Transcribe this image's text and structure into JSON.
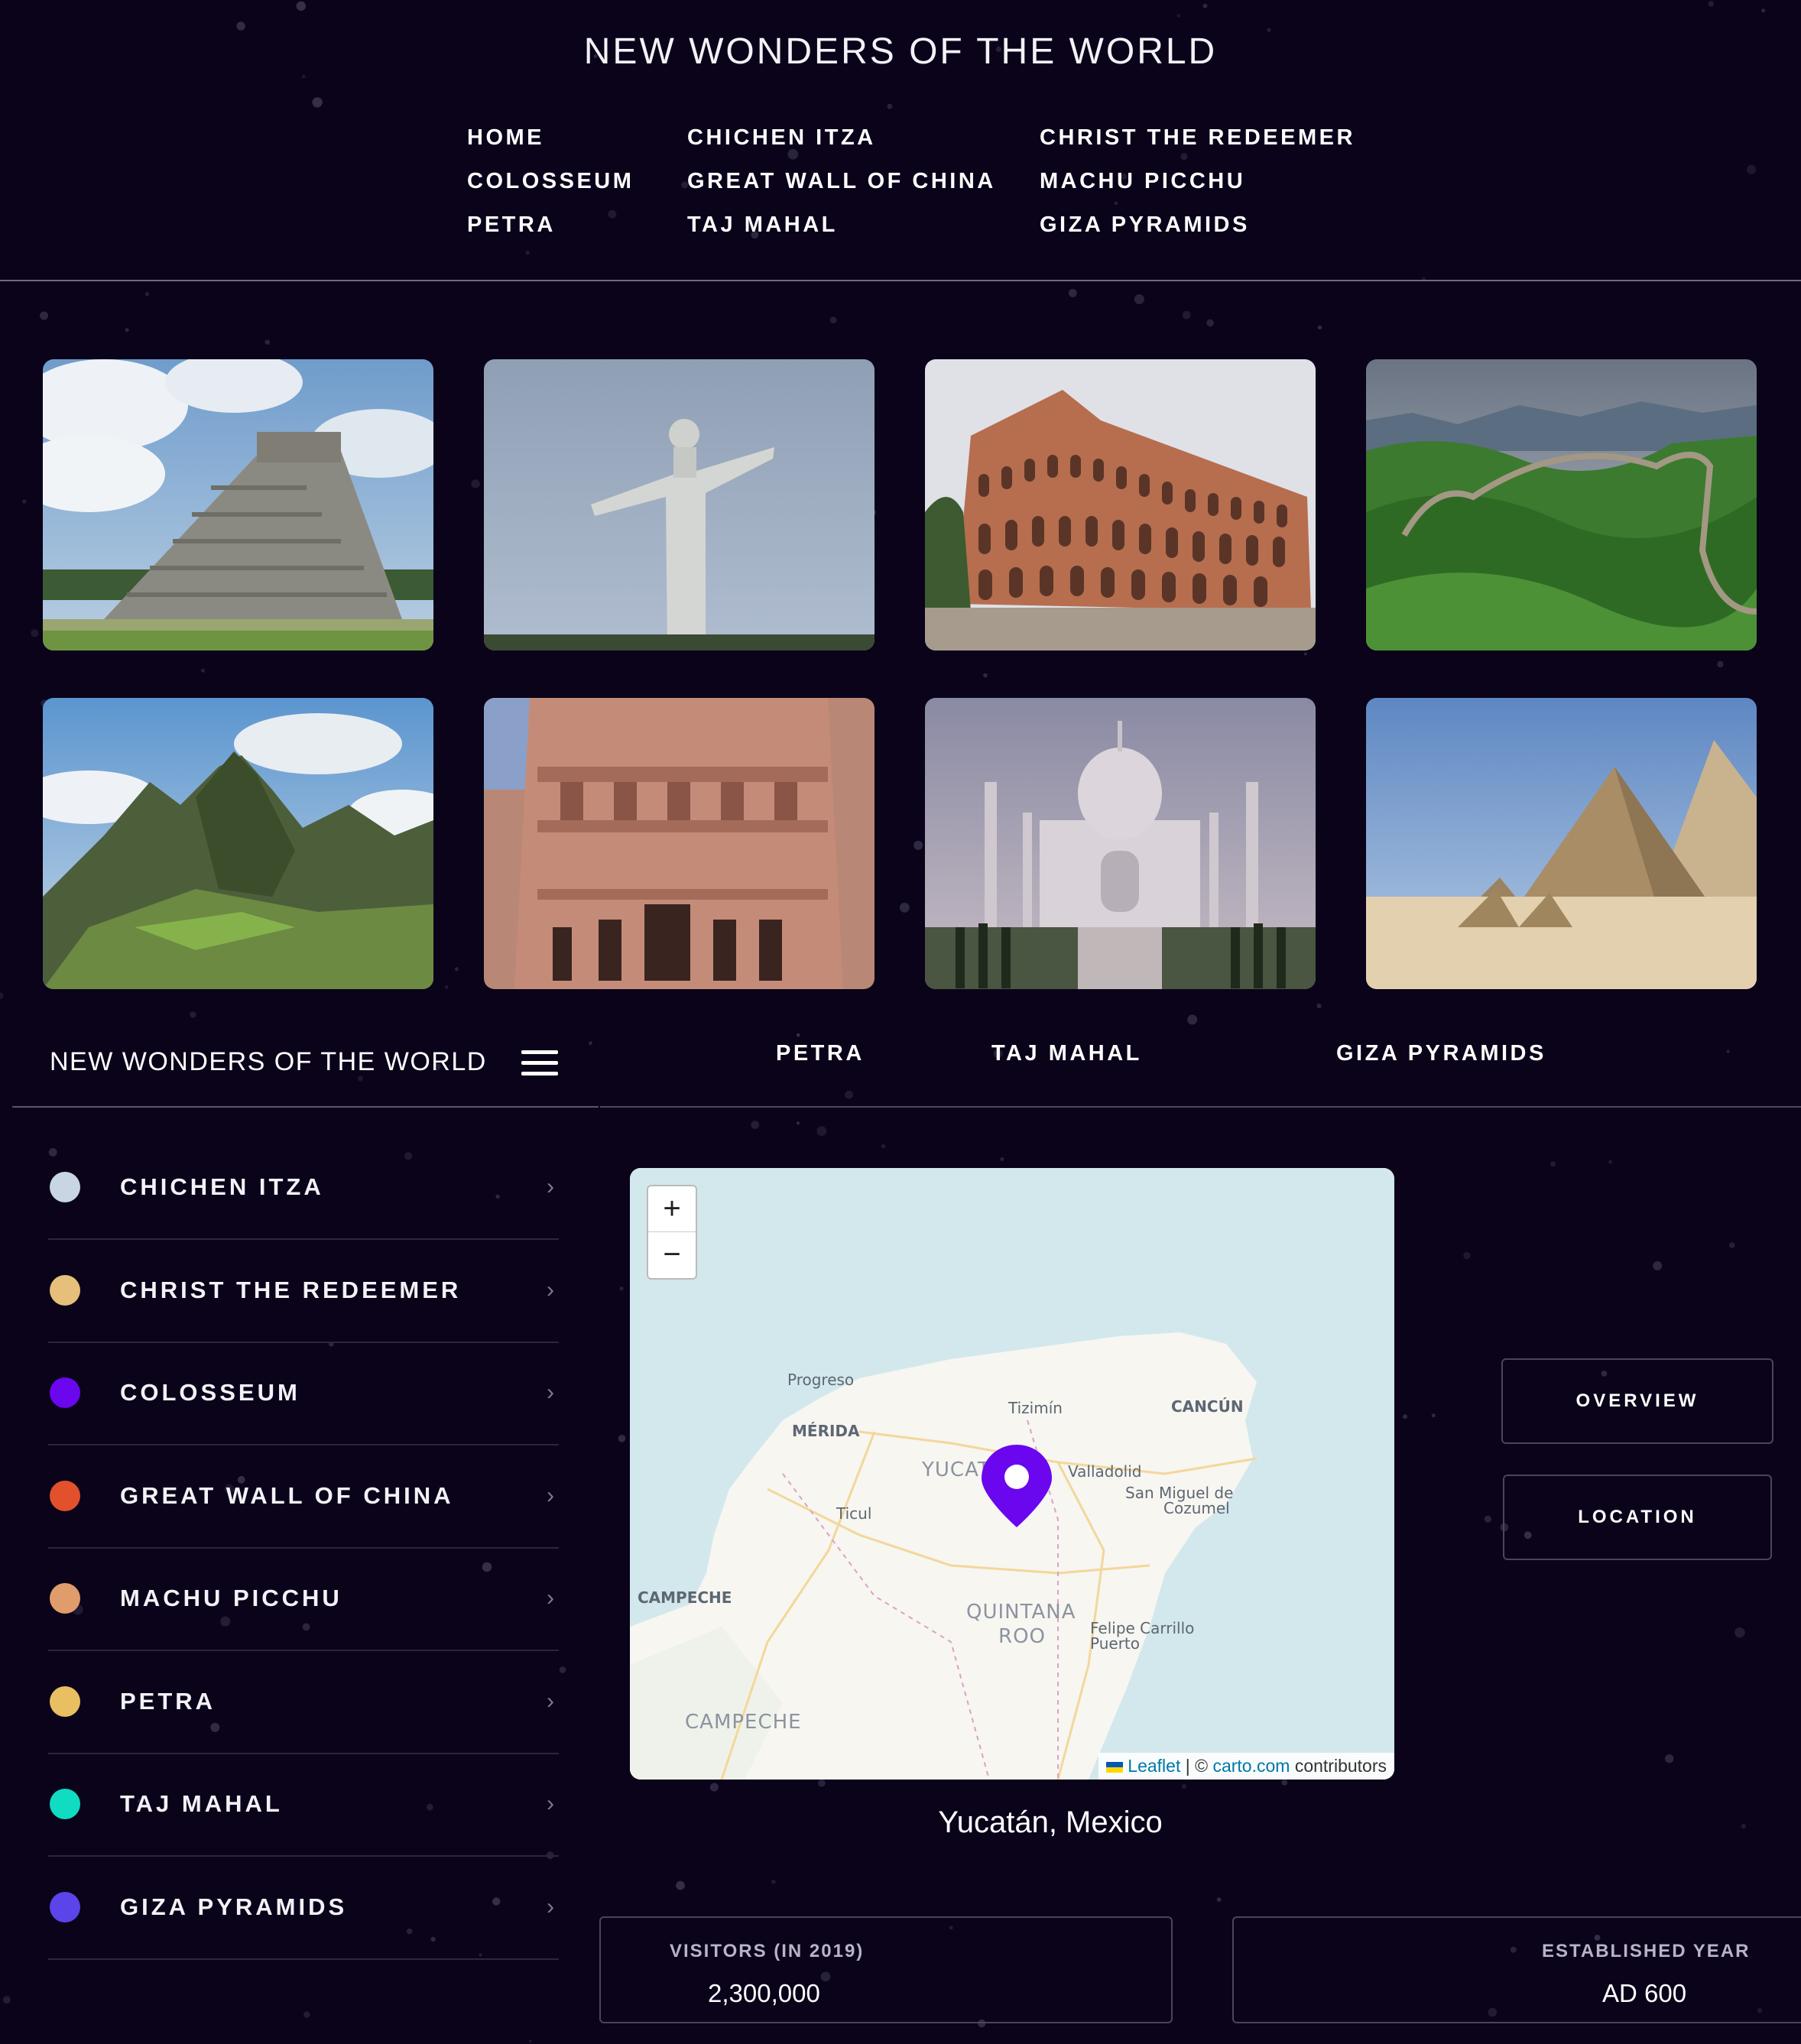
{
  "header": {
    "title": "NEW WONDERS OF THE WORLD",
    "nav": [
      "HOME",
      "CHICHEN ITZA",
      "CHRIST THE REDEEMER",
      "COLOSSEUM",
      "GREAT WALL OF CHINA",
      "MACHU PICCHU",
      "PETRA",
      "TAJ MAHAL",
      "GIZA PYRAMIDS"
    ]
  },
  "gallery": {
    "images": [
      "chichen-itza-photo",
      "christ-the-redeemer-photo",
      "colosseum-photo",
      "great-wall-photo",
      "machu-picchu-photo",
      "petra-photo",
      "taj-mahal-photo",
      "giza-pyramids-photo"
    ]
  },
  "navbar2": {
    "brand": "NEW WONDERS OF THE WORLD",
    "menu_icon": "hamburger-icon",
    "links": [
      "PETRA",
      "TAJ MAHAL",
      "GIZA PYRAMIDS"
    ]
  },
  "sidebar": {
    "items": [
      {
        "label": "CHICHEN ITZA",
        "color": "#c8d6e3"
      },
      {
        "label": "CHRIST THE REDEEMER",
        "color": "#e6c07a"
      },
      {
        "label": "COLOSSEUM",
        "color": "#6a07ee"
      },
      {
        "label": "GREAT WALL OF CHINA",
        "color": "#e2502c"
      },
      {
        "label": "MACHU PICCHU",
        "color": "#e19c6b"
      },
      {
        "label": "PETRA",
        "color": "#e8c062"
      },
      {
        "label": "TAJ MAHAL",
        "color": "#0fdcc1"
      },
      {
        "label": "GIZA PYRAMIDS",
        "color": "#5a44ea"
      }
    ],
    "chevron_icon": "chevron-right-icon"
  },
  "map": {
    "zoom_in": "+",
    "zoom_out": "−",
    "labels": [
      "Progreso",
      "MÉRIDA",
      "Tizimín",
      "CANCÚN",
      "YUCATAN",
      "Valladolid",
      "San Miguel de",
      "Cozumel",
      "Ticul",
      "CAMPECHE",
      "QUINTANA",
      "ROO",
      "Felipe Carrillo",
      "Puerto",
      "CAMPECHE"
    ],
    "attribution": {
      "leaflet": "Leaflet",
      "separator": " | © ",
      "carto": "carto.com",
      "contrib": " contributors"
    },
    "marker_color": "#6a07ee",
    "caption": "Yucatán, Mexico"
  },
  "buttons": {
    "overview": "OVERVIEW",
    "location": "LOCATION"
  },
  "stats": [
    {
      "title": "VISITORS (IN 2019)",
      "value": "2,300,000"
    },
    {
      "title": "ESTABLISHED YEAR",
      "value": "AD 600"
    }
  ]
}
